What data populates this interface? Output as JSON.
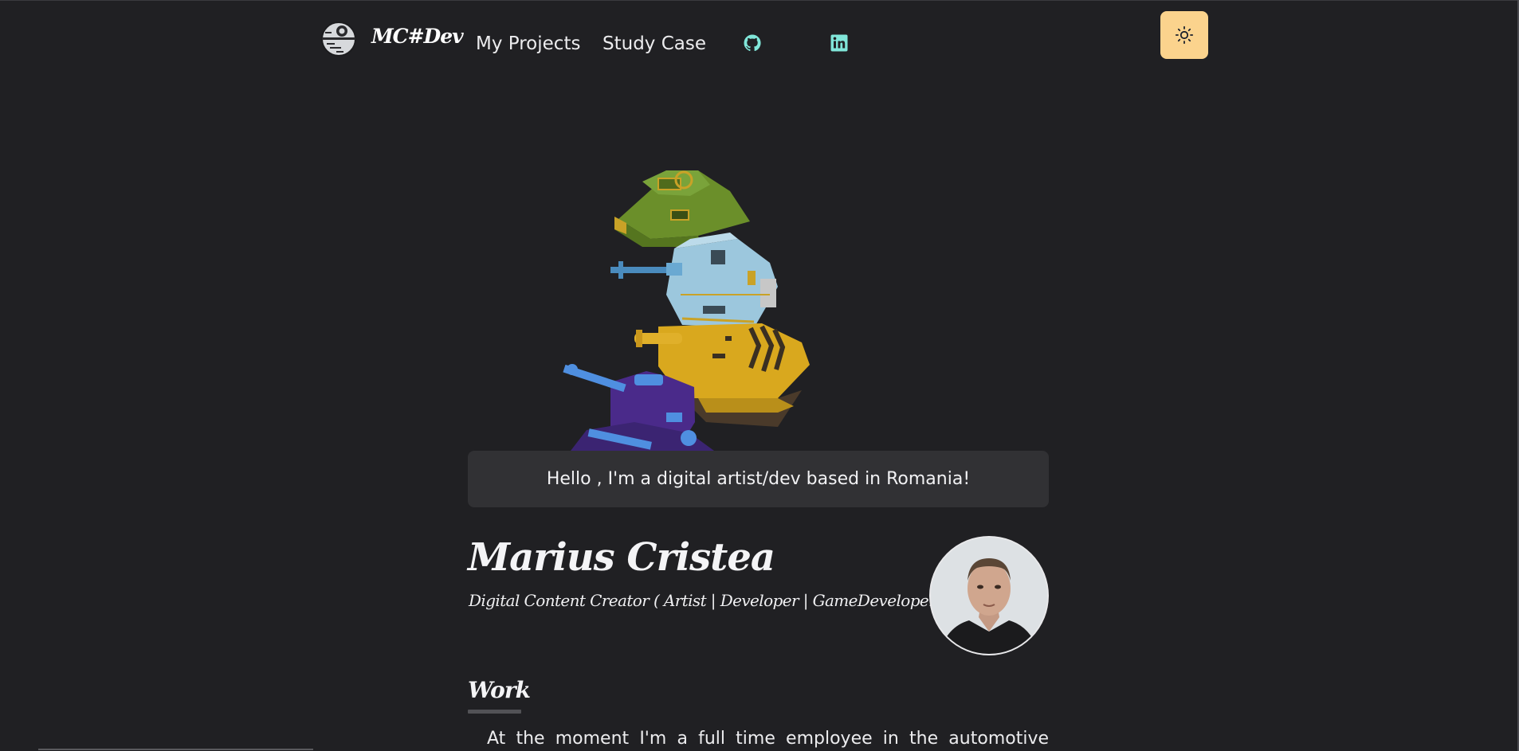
{
  "nav": {
    "brand": "MC#Dev",
    "links": [
      {
        "label": "My Projects"
      },
      {
        "label": "Study Case"
      }
    ],
    "icons": {
      "logo": "death-star-icon",
      "github": "github-icon",
      "linkedin": "linkedin-icon",
      "theme": "sun-icon"
    },
    "toggle_color": "#fbd38d",
    "social_color": "#81e6d9"
  },
  "hero": {
    "image": "stacked-tanks-3d-model",
    "greeting": "Hello , I'm a digital artist/dev based in Romania!"
  },
  "profile": {
    "name": "Marius Cristea",
    "role": "Digital Content Creator ( Artist | Developer | GameDeveloper)",
    "avatar": "profile-photo"
  },
  "work": {
    "title": "Work",
    "text": "At the moment I'm a full time employee in the automotive"
  },
  "colors": {
    "background": "#202023",
    "card": "#313134",
    "text": "#ececee"
  }
}
